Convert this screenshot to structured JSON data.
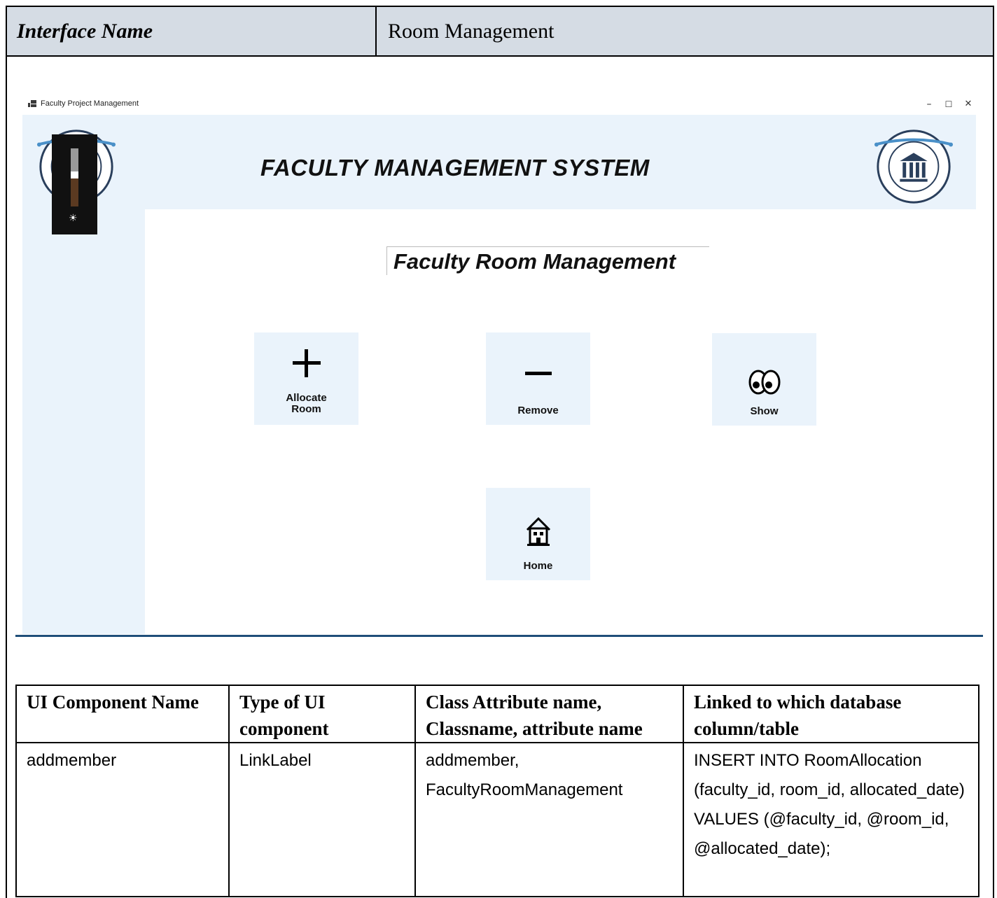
{
  "doc_header": {
    "label": "Interface Name",
    "value": "Room Management"
  },
  "window": {
    "title": "Faculty Project Management",
    "minimize": "–",
    "maximize": "☐",
    "close": "✕"
  },
  "app": {
    "title": "FACULTY MANAGEMENT SYSTEM",
    "subtitle": "Faculty Room Management",
    "logo_text": "FACULTY MANAGEMENT SYSTEM"
  },
  "tiles": [
    {
      "glyph": "+",
      "label": "Allocate\nRoom",
      "icon": "plus-icon"
    },
    {
      "glyph": "—",
      "label": "Remove",
      "icon": "minus-icon"
    },
    {
      "glyph": "eyes",
      "label": "Show",
      "icon": "eyes-icon"
    },
    {
      "glyph": "house",
      "label": "Home",
      "icon": "house-icon"
    }
  ],
  "brightness_popup": {
    "icon": "sun-icon",
    "glyph": "☀",
    "level": 0.6
  },
  "table": {
    "headers": [
      "UI Component Name",
      "Type of UI component",
      "Class Attribute name, Classname, attribute name",
      "Linked to which database column/table"
    ],
    "rows": [
      [
        "addmember",
        "LinkLabel",
        "addmember, FacultyRoomManagement",
        "INSERT INTO RoomAllocation (faculty_id, room_id, allocated_date) VALUES (@faculty_id, @room_id, @allocated_date);"
      ]
    ]
  }
}
